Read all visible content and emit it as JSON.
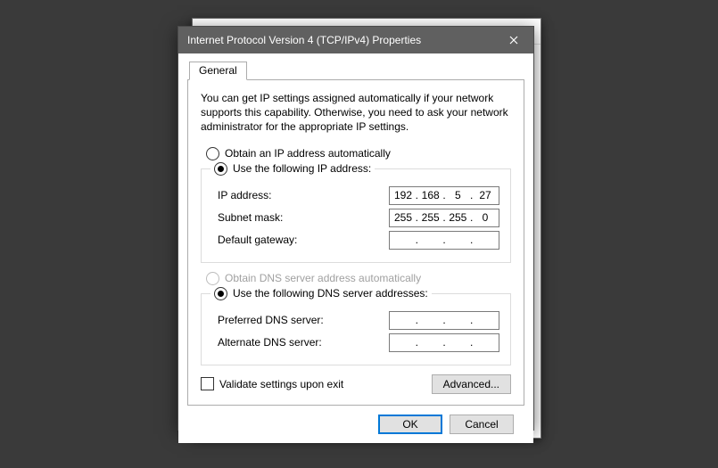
{
  "window": {
    "title": "Internet Protocol Version 4 (TCP/IPv4) Properties"
  },
  "tab": {
    "general": "General"
  },
  "intro": "You can get IP settings assigned automatically if your network supports this capability. Otherwise, you need to ask your network administrator for the appropriate IP settings.",
  "ip": {
    "auto_label": "Obtain an IP address automatically",
    "manual_label": "Use the following IP address:",
    "address_label": "IP address:",
    "subnet_label": "Subnet mask:",
    "gateway_label": "Default gateway:",
    "address": {
      "o1": "192",
      "o2": "168",
      "o3": "5",
      "o4": "27"
    },
    "subnet": {
      "o1": "255",
      "o2": "255",
      "o3": "255",
      "o4": "0"
    },
    "gateway": {
      "o1": "",
      "o2": "",
      "o3": "",
      "o4": ""
    }
  },
  "dns": {
    "auto_label": "Obtain DNS server address automatically",
    "manual_label": "Use the following DNS server addresses:",
    "preferred_label": "Preferred DNS server:",
    "alternate_label": "Alternate DNS server:",
    "preferred": {
      "o1": "",
      "o2": "",
      "o3": "",
      "o4": ""
    },
    "alternate": {
      "o1": "",
      "o2": "",
      "o3": "",
      "o4": ""
    }
  },
  "validate_label": "Validate settings upon exit",
  "buttons": {
    "advanced": "Advanced...",
    "ok": "OK",
    "cancel": "Cancel"
  }
}
